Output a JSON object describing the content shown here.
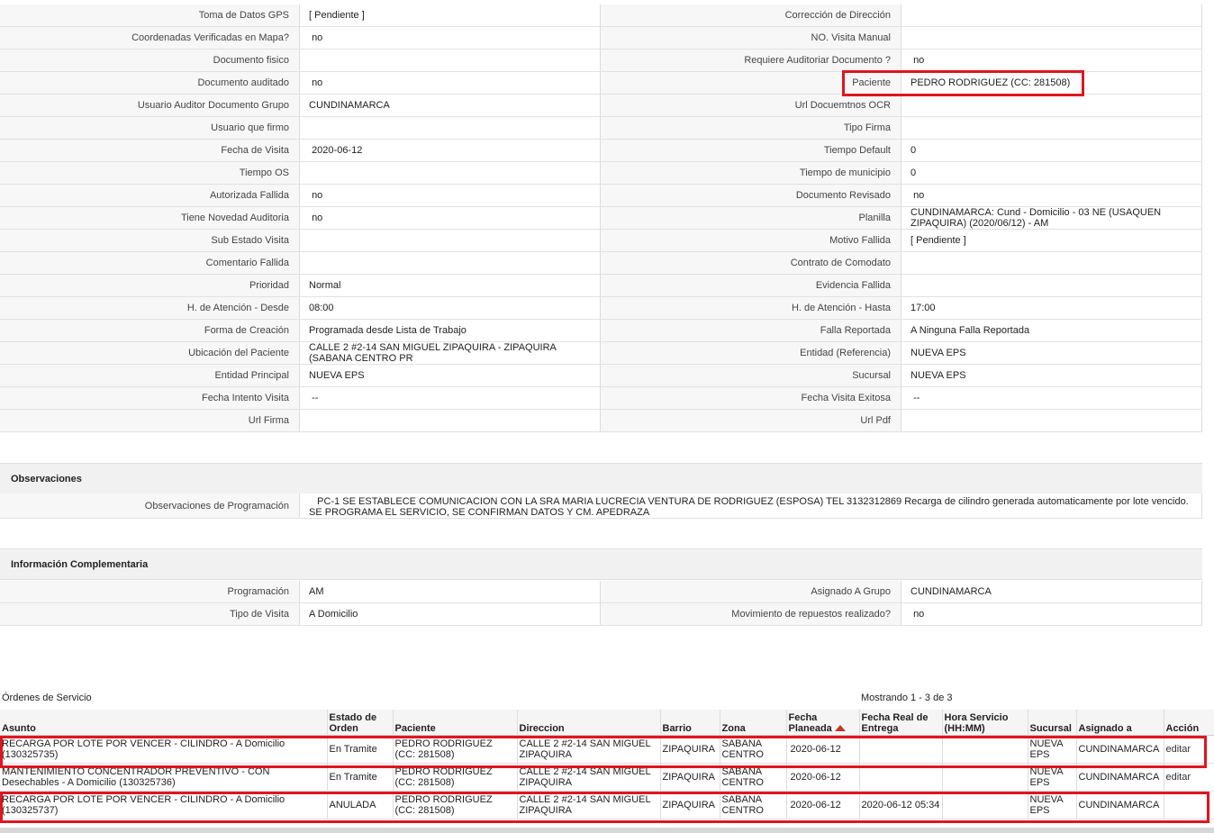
{
  "details": [
    {
      "l1": "Toma de Datos GPS",
      "v1": "[ Pendiente ]",
      "l2": "Corrección de Dirección",
      "v2": ""
    },
    {
      "l1": "Coordenadas Verificadas en Mapa?",
      "v1": " no",
      "l2": "NO. Visita Manual",
      "v2": ""
    },
    {
      "l1": "Documento fisico",
      "v1": "",
      "l2": "Requiere Auditoriar Documento ?",
      "v2": " no"
    },
    {
      "l1": "Documento auditado",
      "v1": " no",
      "l2": "Paciente",
      "v2": "PEDRO RODRIGUEZ (CC: 281508)"
    },
    {
      "l1": "Usuario Auditor Documento Grupo",
      "v1": "CUNDINAMARCA",
      "l2": "Url Docuemtnos OCR",
      "v2": ""
    },
    {
      "l1": "Usuario que firmo",
      "v1": "",
      "l2": "Tipo Firma",
      "v2": ""
    },
    {
      "l1": "Fecha de Visita",
      "v1": " 2020-06-12",
      "l2": "Tiempo Default",
      "v2": "0"
    },
    {
      "l1": "Tiempo OS",
      "v1": "",
      "l2": "Tiempo de municipio",
      "v2": "0"
    },
    {
      "l1": "Autorizada Fallida",
      "v1": " no",
      "l2": "Documento Revisado",
      "v2": " no"
    },
    {
      "l1": "Tiene Novedad Auditoria",
      "v1": " no",
      "l2": "Planilla",
      "v2": "CUNDINAMARCA: Cund - Domicilio - 03 NE (USAQUEN ZIPAQUIRA) (2020/06/12) - AM"
    },
    {
      "l1": "Sub Estado Visita",
      "v1": "",
      "l2": "Motivo Fallida",
      "v2": "[ Pendiente ]"
    },
    {
      "l1": "Comentario Fallida",
      "v1": "",
      "l2": "Contrato de Comodato",
      "v2": ""
    },
    {
      "l1": "Prioridad",
      "v1": "Normal",
      "l2": "Evidencia Fallida",
      "v2": ""
    },
    {
      "l1": "H. de Atención - Desde",
      "v1": "08:00",
      "l2": "H. de Atención - Hasta",
      "v2": "17:00"
    },
    {
      "l1": "Forma de Creación",
      "v1": "Programada desde Lista de Trabajo",
      "l2": "Falla Reportada",
      "v2": "A Ninguna Falla Reportada"
    },
    {
      "l1": "Ubicación del Paciente",
      "v1": "CALLE 2 #2-14 SAN MIGUEL ZIPAQUIRA - ZIPAQUIRA (SABANA CENTRO PR",
      "l2": "Entidad (Referencia)",
      "v2": "NUEVA EPS"
    },
    {
      "l1": "Entidad Principal",
      "v1": "NUEVA EPS",
      "l2": "Sucursal",
      "v2": "NUEVA EPS"
    },
    {
      "l1": "Fecha Intento Visita",
      "v1": " --",
      "l2": "Fecha Visita Exitosa",
      "v2": " --"
    },
    {
      "l1": "Url Firma",
      "v1": "",
      "l2": "Url Pdf",
      "v2": ""
    }
  ],
  "observaciones": {
    "title": "Observaciones",
    "label": "Observaciones de Programación",
    "value": "   PC-1 SE ESTABLECE COMUNICACION CON LA SRA MARIA LUCRECIA VENTURA DE RODRIGUEZ (ESPOSA) TEL 3132312869 Recarga de cilindro generada automaticamente por lote vencido. SE PROGRAMA EL SERVICIO, SE CONFIRMAN DATOS Y CM. APEDRAZA"
  },
  "info_complementaria": {
    "title": "Información Complementaria",
    "rows": [
      {
        "l1": "Programación",
        "v1": "AM",
        "l2": "Asignado A Grupo",
        "v2": "CUNDINAMARCA"
      },
      {
        "l1": "Tipo de Visita",
        "v1": "A Domicilio",
        "l2": "Movimiento de repuestos realizado?",
        "v2": " no"
      }
    ]
  },
  "orders": {
    "title": "Órdenes de Servicio",
    "count_text": "Mostrando 1 - 3 de 3",
    "columns": [
      "Asunto",
      "Estado de Orden",
      "Paciente",
      "Direccion",
      "Barrio",
      "Zona",
      "Fecha Planeada",
      "Fecha Real de Entrega",
      "Hora Servicio (HH:MM)",
      "Sucursal",
      "Asignado a",
      "Acción"
    ],
    "rows": [
      {
        "asunto": "RECARGA POR LOTE POR VENCER - CILINDRO - A Domicilio (130325735)",
        "estado": "En Tramite",
        "paciente": "PEDRO RODRIGUEZ (CC: 281508)",
        "direccion": "CALLE 2 #2-14 SAN MIGUEL ZIPAQUIRA",
        "barrio": "ZIPAQUIRA",
        "zona": "SABANA CENTRO",
        "fecha_planeada": "2020-06-12",
        "fecha_real": "",
        "hora": "",
        "sucursal": "NUEVA EPS",
        "asignado": "CUNDINAMARCA",
        "accion": "editar"
      },
      {
        "asunto": "MANTENIMIENTO CONCENTRADOR PREVENTIVO - CON Desechables - A Domicilio (130325736)",
        "estado": "En Tramite",
        "paciente": "PEDRO RODRIGUEZ (CC: 281508)",
        "direccion": "CALLE 2 #2-14 SAN MIGUEL ZIPAQUIRA",
        "barrio": "ZIPAQUIRA",
        "zona": "SABANA CENTRO",
        "fecha_planeada": "2020-06-12",
        "fecha_real": "",
        "hora": "",
        "sucursal": "NUEVA EPS",
        "asignado": "CUNDINAMARCA",
        "accion": "editar"
      },
      {
        "asunto": "RECARGA POR LOTE POR VENCER - CILINDRO - A Domicilio (130325737)",
        "estado": "ANULADA",
        "paciente": "PEDRO RODRIGUEZ (CC: 281508)",
        "direccion": "CALLE 2 #2-14 SAN MIGUEL ZIPAQUIRA",
        "barrio": "ZIPAQUIRA",
        "zona": "SABANA CENTRO",
        "fecha_planeada": "2020-06-12",
        "fecha_real": "2020-06-12 05:34",
        "hora": "",
        "sucursal": "NUEVA EPS",
        "asignado": "CUNDINAMARCA",
        "accion": ""
      }
    ]
  },
  "colors": {
    "highlight": "#e0151f",
    "sort_indicator": "#c0392b",
    "label_bg": "#f7f7f7"
  }
}
